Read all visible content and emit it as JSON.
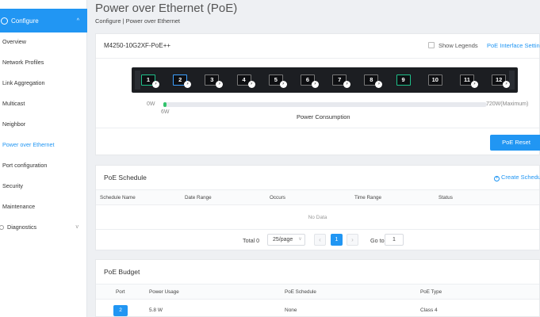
{
  "sidebar": {
    "header": "Configure",
    "items": [
      "Overview",
      "Network Profiles",
      "Link Aggregation",
      "Multicast",
      "Neighbor",
      "Power over Ethernet",
      "Port configuration",
      "Security",
      "Maintenance"
    ],
    "active": "Power over Ethernet",
    "diagnostics": "Diagnostics"
  },
  "header": {
    "title": "Power over Ethernet (PoE)",
    "breadcrumb": "Configure | Power over Ethernet"
  },
  "device": {
    "model": "M4250-10G2XF-PoE++",
    "show_legends": "Show Legends",
    "interface_settings": "PoE Interface Settings",
    "ports": [
      {
        "num": "1",
        "style": "green",
        "poe": true
      },
      {
        "num": "2",
        "style": "blue",
        "poe": true
      },
      {
        "num": "3",
        "style": "plain",
        "poe": true
      },
      {
        "num": "4",
        "style": "plain",
        "poe": true
      },
      {
        "num": "5",
        "style": "plain",
        "poe": true
      },
      {
        "num": "6",
        "style": "plain",
        "poe": true
      },
      {
        "num": "7",
        "style": "plain",
        "poe": true
      },
      {
        "num": "8",
        "style": "plain",
        "poe": true
      },
      {
        "num": "9",
        "style": "green",
        "poe": false
      },
      {
        "num": "10",
        "style": "plain",
        "poe": false
      },
      {
        "num": "11",
        "style": "plain",
        "poe": true
      },
      {
        "num": "12",
        "style": "plain",
        "poe": true
      }
    ],
    "poe_badge": "⚡"
  },
  "power": {
    "min": "0W",
    "max": "720W(Maximum)",
    "used": "6W",
    "used_fraction": 0.0083,
    "caption": "Power Consumption",
    "reset": "PoE Reset"
  },
  "schedule": {
    "title": "PoE Schedule",
    "create": "Create Schedule",
    "columns": [
      "Schedule Name",
      "Date Range",
      "Occurs",
      "Time Range",
      "Status"
    ],
    "empty": "No Data",
    "total": "Total 0",
    "page_size": "25/page",
    "current_page": "1",
    "goto_label": "Go to",
    "goto_value": "1"
  },
  "budget": {
    "title": "PoE Budget",
    "columns": [
      "Port",
      "Power Usage",
      "PoE Schedule",
      "PoE Type"
    ],
    "rows": [
      {
        "port": "2",
        "usage": "5.8 W",
        "schedule": "None",
        "type": "Class 4"
      }
    ]
  },
  "colors": {
    "accent": "#2196f3",
    "port_green": "#1fc08a",
    "power_fill": "#32c36c"
  }
}
